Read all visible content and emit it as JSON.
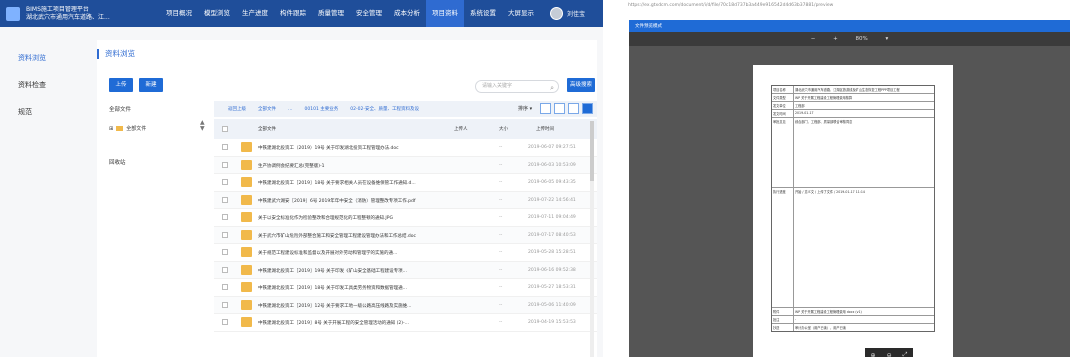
{
  "app": {
    "brand_line1": "BIMS施工项目管理平台",
    "brand_line2": "湖北武穴市通用汽车道路、江...",
    "menu": [
      "项目概况",
      "模型浏览",
      "生产进度",
      "构件跟踪",
      "质量管理",
      "安全管理",
      "成本分析",
      "项目资料",
      "系统设置",
      "大屏显示"
    ],
    "active_menu": "项目资料",
    "user": "刘佳宝"
  },
  "sidebar": {
    "items": [
      {
        "label": "资料浏览",
        "active": true
      },
      {
        "label": "资料检查",
        "active": false
      },
      {
        "label": "规范",
        "active": false
      }
    ]
  },
  "main": {
    "title": "资料浏览",
    "upload_label": "上传",
    "new_label": "新建",
    "search_placeholder": "请输入关键字",
    "advanced_search_label": "高级搜索",
    "tree": {
      "root": "全部文件",
      "child": "全部文件",
      "recycle": "回收站"
    },
    "breadcrumb": [
      "返回上级",
      "全部文件",
      "…",
      "00101 主要业务",
      "02-02-安全、质量、工程资料及设"
    ],
    "sort_label": "排序",
    "columns": {
      "name": "全部文件",
      "uploader": "上传人",
      "size": "大小",
      "time": "上传时间"
    },
    "files": [
      {
        "name": "中铁建湖北投资工（2019）19号 关于印发湖北投资工程管理办法.doc",
        "size": "--",
        "time": "2019-06-07 09:27:51"
      },
      {
        "name": "生产协调例会纪要汇总(完整版)-1",
        "size": "--",
        "time": "2019-06-03 10:53:09"
      },
      {
        "name": "中铁建湖北投资工［2019］18号 关于要求相关人员在设备维保管工作通知.d...",
        "size": "--",
        "time": "2019-06-05 09:43:35"
      },
      {
        "name": "中铁建武穴湖安［2019］6号 2019年年中安全（消防）管理整改专项工作.pdf",
        "size": "--",
        "time": "2019-07-22 14:56:41"
      },
      {
        "name": "关于以安全标准化作为检验整改和合理规范化的工程整顿的通知.JPG",
        "size": "--",
        "time": "2019-07-11 09:04:49"
      },
      {
        "name": "关于武穴市矿山危险外部整合施工和安全管理工程建设管理办法和工作总结.doc",
        "size": "--",
        "time": "2019-07-17 08:40:53"
      },
      {
        "name": "关于规范工程建设标准和监督以及开展对外劳动和管理学的实施的通...",
        "size": "--",
        "time": "2019-05-28 15:28:51"
      },
      {
        "name": "中铁建湖北投资工［2019］19号 关于印发《矿山安全基础工程建设专项...",
        "size": "--",
        "time": "2019-06-16 09:52:38"
      },
      {
        "name": "中铁建湖北投资工［2019］18号 关于印发工具类劳务物资和数据管理通...",
        "size": "--",
        "time": "2019-05-27 18:53:31"
      },
      {
        "name": "中铁建湖北投资工［2019］12号 关于要求工地一级公路高压线路及实施维...",
        "size": "--",
        "time": "2019-05-06 11:40:09"
      },
      {
        "name": "中铁建湖北投资工［2019］8号 关于开展工程的安全管理活动的通知 (2)-...",
        "size": "--",
        "time": "2019-04-19 15:53:53"
      }
    ]
  },
  "preview": {
    "url": "https://ex.gtxdcm.com/document/i/d/file/70c18d737b3a449e916542d4d63b37881/preview",
    "viewer_button": "文件预览模式",
    "zoom_text": "80%",
    "doc_rows": [
      {
        "k": "项目名称",
        "v": "湖北武穴市通用汽车道路、江湖区旅游线及矿山生态恢复工程PPP项目工程"
      },
      {
        "k": "文件类型",
        "v": "WP 关于开展工程建设工程管理费用核算"
      },
      {
        "k": "发文单位",
        "v": "工程部"
      },
      {
        "k": "发文时间",
        "v": "2019-01-17"
      },
      {
        "k": "审批意见",
        "v": "综合部门、工程部、质量部联合审核同意"
      },
      {
        "k": "执行进度",
        "v": "开始 / 意义文 / 上传了文件 / 2019-01-17 11:14"
      },
      {
        "k": "附件",
        "v": "WP 关于开展工程建设工程管理费用 docx (v1)"
      },
      {
        "k": "批注",
        "v": "-"
      },
      {
        "k": "抄送",
        "v": "审计办公室（用户已读），用户已读"
      }
    ]
  }
}
